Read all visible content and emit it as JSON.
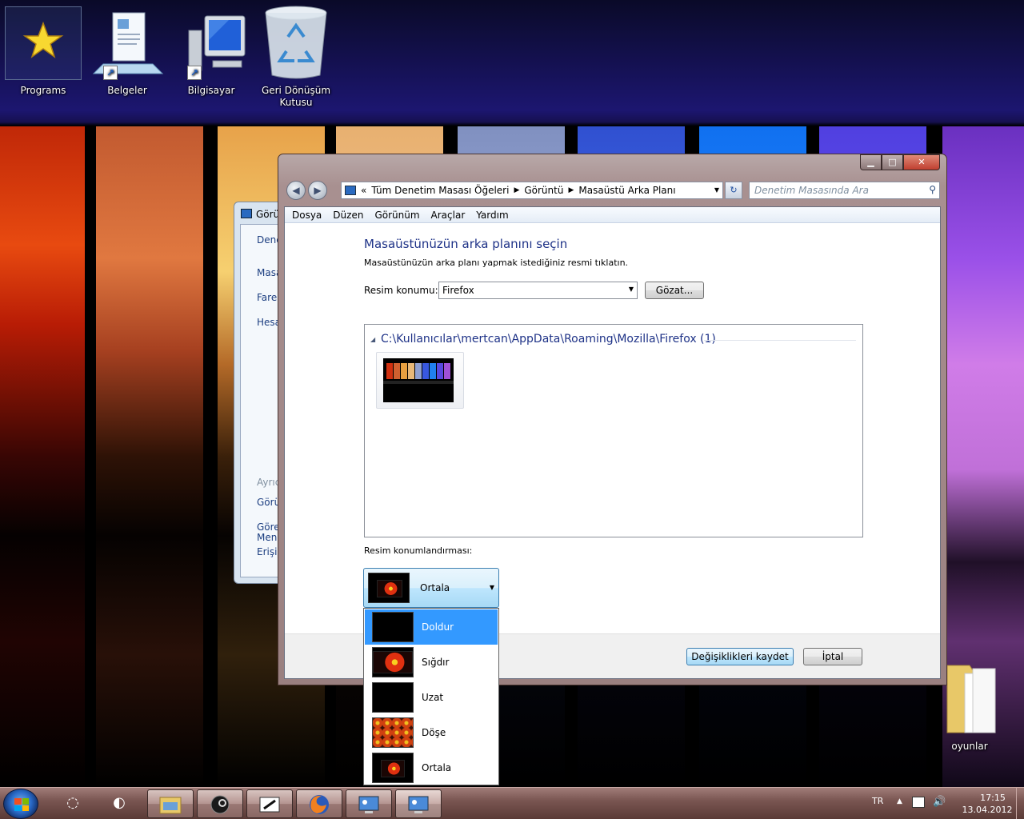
{
  "desktop": {
    "icons": [
      {
        "label": "Programs",
        "line2": ""
      },
      {
        "label": "Belgeler",
        "line2": ""
      },
      {
        "label": "Bilgisayar",
        "line2": ""
      },
      {
        "label": "Geri Dönüşüm",
        "line2": "Kutusu"
      },
      {
        "label": "oyunlar",
        "line2": ""
      }
    ]
  },
  "back_window": {
    "title": "Görü",
    "items": [
      "Dene",
      "Masa",
      "Fare",
      "Hesa",
      "Ayrıc",
      "Görü",
      "Göre",
      "Menü",
      "Erişin"
    ]
  },
  "window": {
    "title": "Masaüstü Arka Planı",
    "breadcrumb": {
      "prefix": "«",
      "items": [
        "Tüm Denetim Masası Öğeleri",
        "Görüntü",
        "Masaüstü Arka Planı"
      ]
    },
    "search_placeholder": "Denetim Masasında Ara",
    "menu": [
      "Dosya",
      "Düzen",
      "Görünüm",
      "Araçlar",
      "Yardım"
    ],
    "heading": "Masaüstünüzün arka planını seçin",
    "subheading": "Masaüstünüzün arka planı yapmak istediğiniz resmi tıklatın.",
    "location_label": "Resim konumu:",
    "location_value": "Firefox",
    "browse_label": "Gözat...",
    "group_header": "C:\\Kullanıcılar\\mertcan\\AppData\\Roaming\\Mozilla\\Firefox (1)",
    "position_label": "Resim konumlandırması:",
    "position_value": "Ortala",
    "position_options": [
      "Doldur",
      "Sığdır",
      "Uzat",
      "Döşe",
      "Ortala"
    ],
    "highlighted_option": "Doldur",
    "save_label": "Değişiklikleri kaydet",
    "cancel_label": "İptal"
  },
  "taskbar": {
    "language": "TR",
    "time": "17:15",
    "date": "13.04.2012"
  },
  "colors": {
    "heading": "#1e3287",
    "selection": "#3399ff",
    "taskbar": "#7a5652"
  }
}
